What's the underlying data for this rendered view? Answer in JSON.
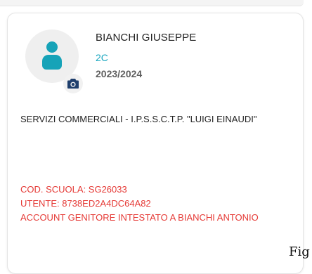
{
  "student": {
    "name": "BIANCHI GIUSEPPE",
    "class": "2C",
    "year": "2023/2024"
  },
  "school": {
    "name": "SERVIZI COMMERCIALI - I.P.S.S.C.T.P. \"LUIGI EINAUDI\""
  },
  "account": {
    "school_code": "COD. SCUOLA: SG26033",
    "user": "UTENTE: 8738ED2A4DC64A82",
    "holder": "ACCOUNT GENITORE INTESTATO A BIANCHI ANTONIO"
  },
  "caption_fragment": "Fig",
  "colors": {
    "accent": "#16a3b8",
    "alert": "#e53935",
    "camera_icon": "#1f3f6d"
  },
  "icons": {
    "avatar": "person-icon",
    "camera": "camera-icon"
  }
}
